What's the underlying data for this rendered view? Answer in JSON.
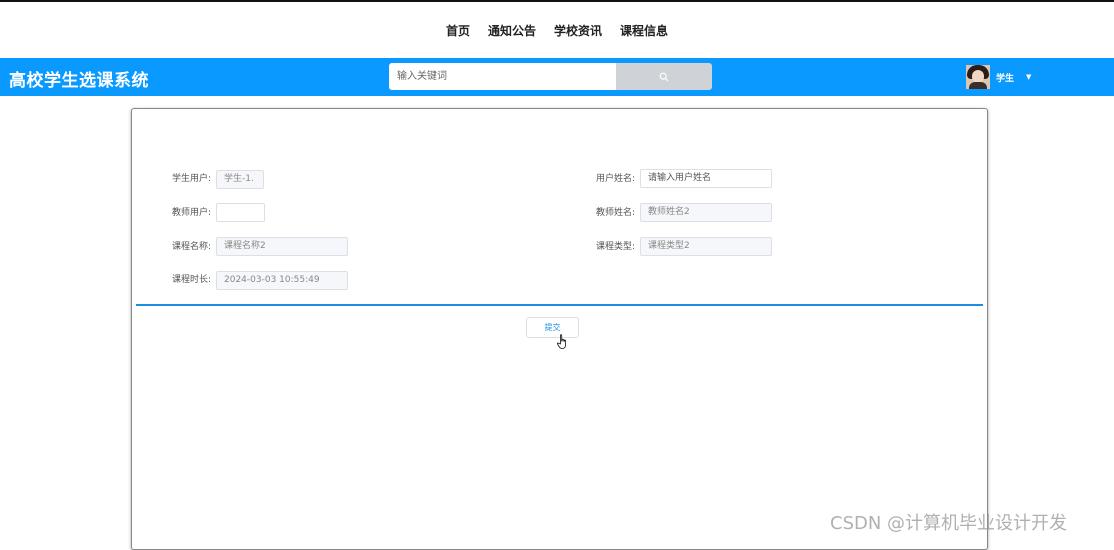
{
  "topnav": {
    "items": [
      {
        "label": "首页"
      },
      {
        "label": "通知公告"
      },
      {
        "label": "学校资讯"
      },
      {
        "label": "课程信息"
      }
    ]
  },
  "header": {
    "title": "高校学生选课系统",
    "search": {
      "placeholder": "输入关键词",
      "value": ""
    },
    "search_icon": "search-icon",
    "user": {
      "name": "学生",
      "dropdown_icon": "caret-down-icon"
    },
    "color": "#0a99ff"
  },
  "form": {
    "fields": {
      "student_user": {
        "label": "学生用户:",
        "value": "学生-1."
      },
      "user_name": {
        "label": "用户姓名:",
        "placeholder": "请输入用户姓名"
      },
      "teacher_user": {
        "label": "教师用户:",
        "value": ""
      },
      "teacher_name": {
        "label": "教师姓名:",
        "value": "教师姓名2"
      },
      "course_name": {
        "label": "课程名称:",
        "value": "课程名称2"
      },
      "course_type": {
        "label": "课程类型:",
        "value": "课程类型2"
      },
      "course_duration": {
        "label": "课程时长:",
        "value": "2024-03-03 10:55:49"
      }
    },
    "submit_label": "提交",
    "divider_color": "#1a8fe0"
  },
  "watermark": "CSDN @计算机毕业设计开发"
}
